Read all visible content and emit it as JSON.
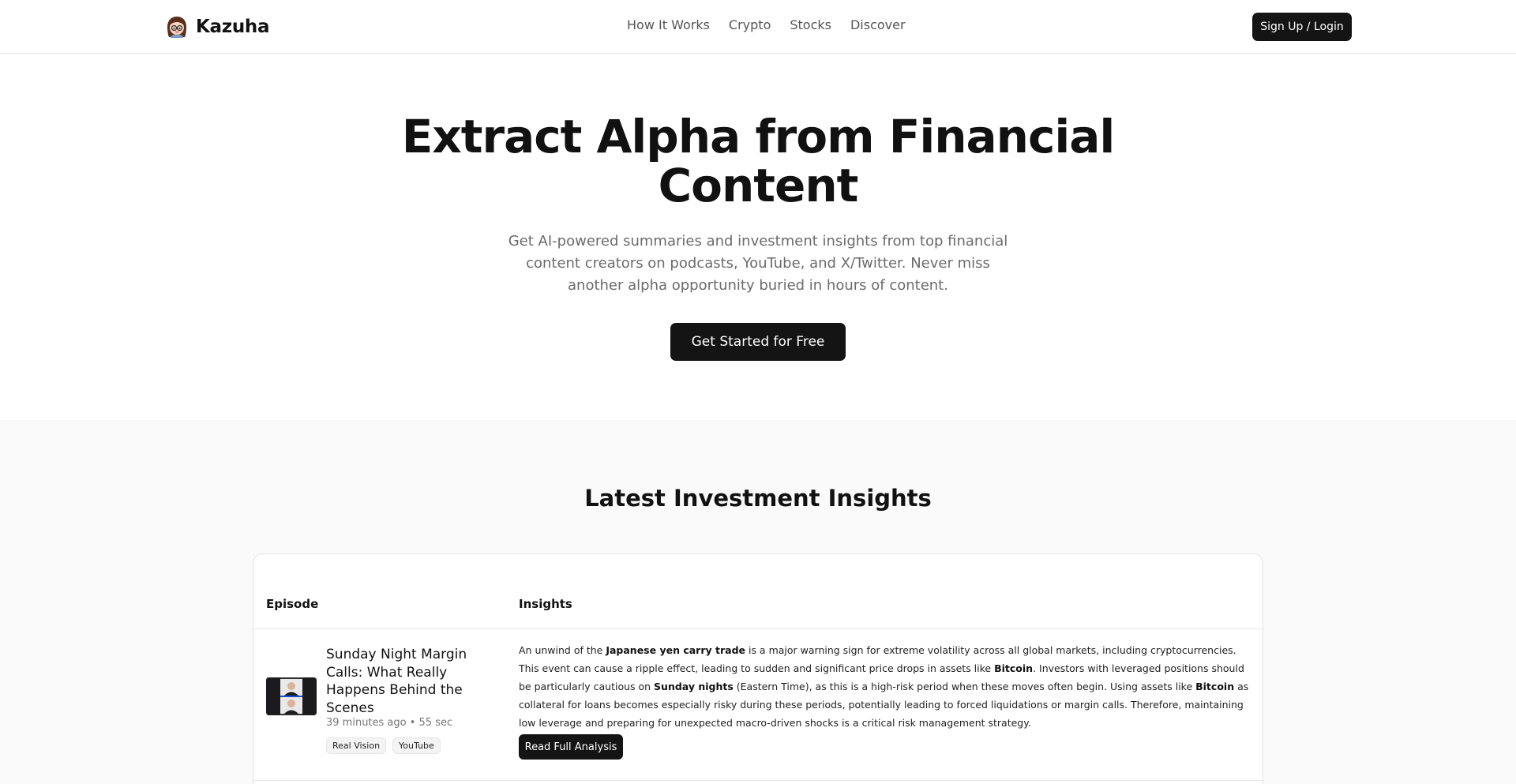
{
  "header": {
    "brand": "Kazuha",
    "nav": [
      "How It Works",
      "Crypto",
      "Stocks",
      "Discover"
    ],
    "signup_label": "Sign Up / Login"
  },
  "hero": {
    "title": "Extract Alpha from Financial Content",
    "subtitle": "Get AI-powered summaries and investment insights from top financial content creators on podcasts, YouTube, and X/Twitter. Never miss another alpha opportunity buried in hours of content.",
    "cta_label": "Get Started for Free"
  },
  "insights": {
    "section_title": "Latest Investment Insights",
    "columns": [
      "Episode",
      "Insights"
    ],
    "rows": [
      {
        "title": "Sunday Night Margin Calls: What Really Happens Behind the Scenes",
        "meta": "39 minutes ago • 55 sec",
        "tags": [
          "Real Vision",
          "YouTube"
        ],
        "insight_parts": [
          "An unwind of the ",
          "Japanese yen carry trade",
          " is a major warning sign for extreme volatility across all global markets, including cryptocurrencies. This event can cause a ripple effect, leading to sudden and significant price drops in assets like ",
          "Bitcoin",
          ". Investors with leveraged positions should be particularly cautious on ",
          "Sunday nights",
          " (Eastern Time), as this is a high-risk period when these moves often begin. Using assets like ",
          "Bitcoin",
          " as collateral for loans becomes especially risky during these periods, potentially leading to forced liquidations or margin calls. Therefore, maintaining low leverage and preparing for unexpected macro-driven shocks is a critical risk management strategy."
        ],
        "read_label": "Read Full Analysis"
      }
    ]
  },
  "colors": {
    "accent": "#141414",
    "muted_text": "#6b6b6b",
    "section_bg": "#fafafa",
    "border": "#e5e7eb"
  }
}
